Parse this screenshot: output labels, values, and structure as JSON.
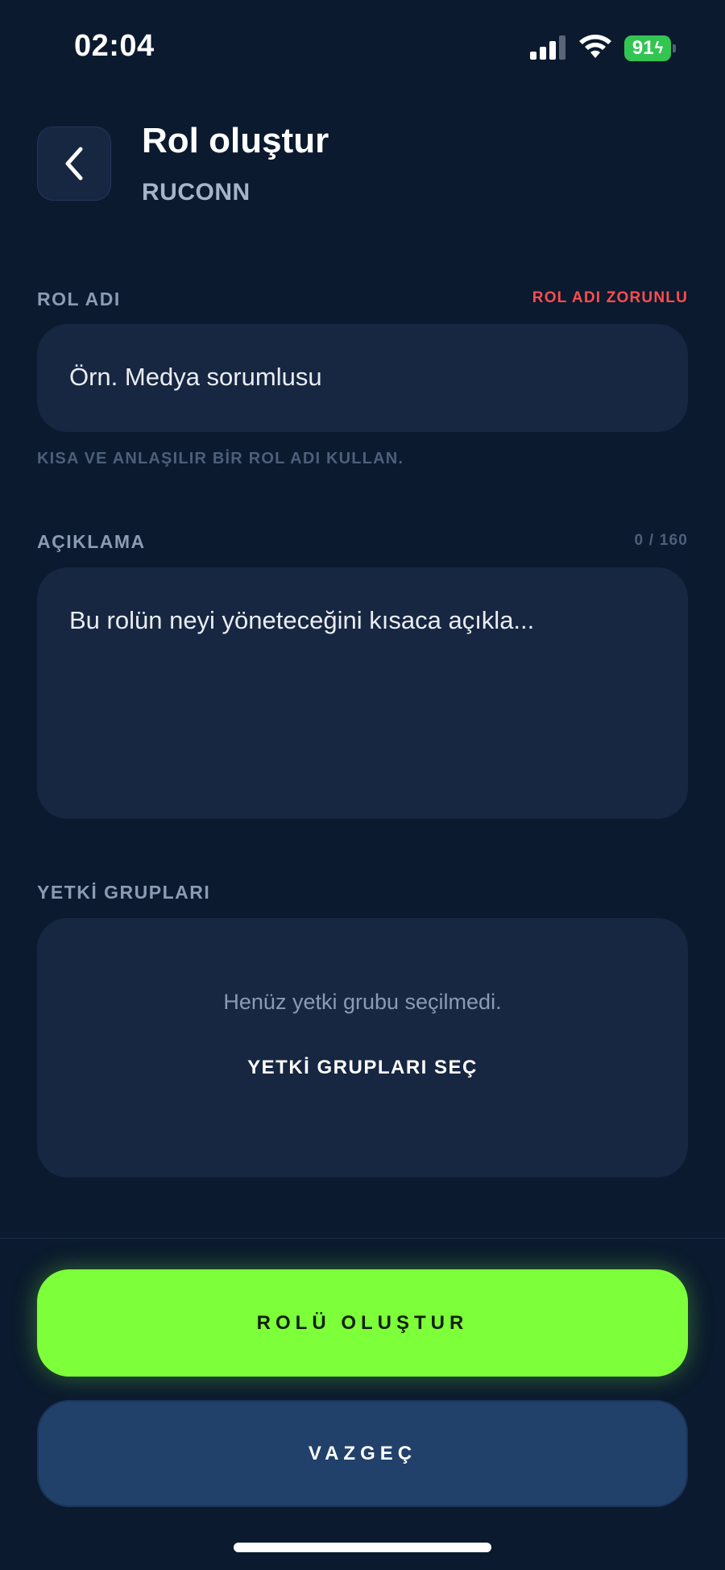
{
  "status_bar": {
    "time": "02:04",
    "battery_level": "91",
    "signal_icon": "cellular-signal-icon",
    "wifi_icon": "wifi-icon",
    "battery_icon": "battery-charging-icon",
    "battery_color": "#32c552"
  },
  "header": {
    "back_icon": "chevron-left-icon",
    "title": "Rol oluştur",
    "subtitle": "RUCONN"
  },
  "role_name": {
    "label": "ROL ADI",
    "error": "ROL ADI ZORUNLU",
    "error_color": "#ff4d4f",
    "placeholder": "Örn. Medya sorumlusu",
    "value": "",
    "hint": "KISA VE ANLAŞILIR BİR ROL ADI KULLAN."
  },
  "description": {
    "label": "AÇIKLAMA",
    "counter": "0 / 160",
    "placeholder": "Bu rolün neyi yöneteceğini kısaca açıkla...",
    "value": ""
  },
  "permission_groups": {
    "label": "YETKİ GRUPLARI",
    "empty_text": "Henüz yetki grubu seçilmedi.",
    "select_label": "YETKİ GRUPLARI SEÇ"
  },
  "actions": {
    "primary_label": "ROLÜ OLUŞTUR",
    "primary_color": "#7dff3a",
    "secondary_label": "VAZGEÇ",
    "secondary_color": "#21406a"
  }
}
